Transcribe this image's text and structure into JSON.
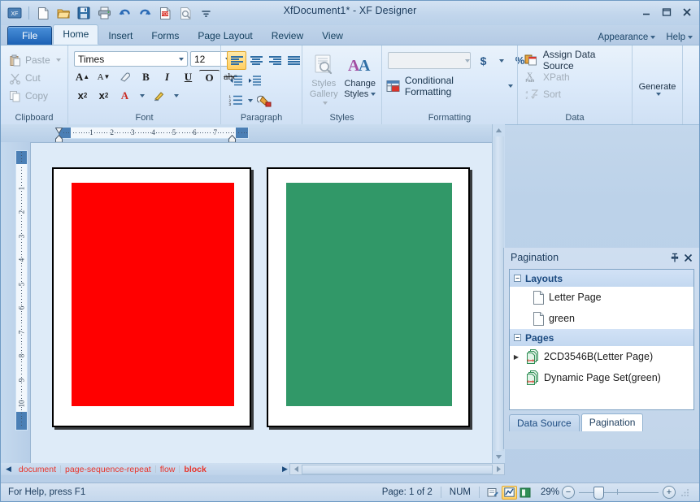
{
  "window": {
    "title": "XfDocument1* - XF Designer",
    "minimize": "minimize-button",
    "maximize": "maximize-button",
    "close": "close-button"
  },
  "quick_access": {
    "items": [
      {
        "name": "app-logo-icon",
        "label": "XF"
      },
      {
        "name": "new-document-icon",
        "label": "New"
      },
      {
        "name": "open-folder-icon",
        "label": "Open"
      },
      {
        "name": "save-icon",
        "label": "Save"
      },
      {
        "name": "print-icon",
        "label": "Print"
      },
      {
        "name": "undo-icon",
        "label": "Undo"
      },
      {
        "name": "redo-icon",
        "label": "Redo"
      },
      {
        "name": "pdf-export-icon",
        "label": "Export PDF"
      },
      {
        "name": "preview-icon",
        "label": "Print Preview"
      },
      {
        "name": "customize-qat-icon",
        "label": "Customize"
      }
    ]
  },
  "tabs": {
    "file": "File",
    "items": [
      {
        "label": "Home",
        "active": true
      },
      {
        "label": "Insert",
        "active": false
      },
      {
        "label": "Forms",
        "active": false
      },
      {
        "label": "Page Layout",
        "active": false
      },
      {
        "label": "Review",
        "active": false
      },
      {
        "label": "View",
        "active": false
      }
    ],
    "right": [
      {
        "label": "Appearance"
      },
      {
        "label": "Help"
      }
    ]
  },
  "ribbon": {
    "clipboard": {
      "label": "Clipboard",
      "paste": "Paste",
      "cut": "Cut",
      "copy": "Copy"
    },
    "font": {
      "label": "Font",
      "font_name": "Times",
      "font_size": "12",
      "buttons": [
        {
          "name": "grow-font",
          "glyph": "A"
        },
        {
          "name": "shrink-font",
          "glyph": "A"
        },
        {
          "name": "clear-formatting",
          "glyph": "eraser"
        },
        {
          "name": "bold",
          "glyph": "B"
        },
        {
          "name": "italic",
          "glyph": "I"
        },
        {
          "name": "underline",
          "glyph": "U"
        },
        {
          "name": "overline",
          "glyph": "O"
        },
        {
          "name": "strikethrough",
          "glyph": "abc"
        },
        {
          "name": "subscript",
          "glyph": "x2"
        },
        {
          "name": "superscript",
          "glyph": "x2"
        },
        {
          "name": "font-color",
          "glyph": "A"
        },
        {
          "name": "highlight-color",
          "glyph": "pen"
        }
      ]
    },
    "paragraph": {
      "label": "Paragraph",
      "align_left": "Align Left",
      "align_center": "Center",
      "align_right": "Align Right",
      "justify": "Justify",
      "decrease_indent": "Decrease Indent",
      "increase_indent": "Increase Indent",
      "numbering": "Numbering",
      "shading": "Shading"
    },
    "styles": {
      "label": "Styles",
      "styles_gallery": "Styles\nGallery",
      "styles_gallery_line1": "Styles",
      "styles_gallery_line2": "Gallery",
      "change_styles_line1": "Change",
      "change_styles_line2": "Styles"
    },
    "formatting": {
      "label": "Formatting",
      "number_format_value": "",
      "currency": "$",
      "percent": "%",
      "conditional_formatting": "Conditional Formatting"
    },
    "data": {
      "label": "Data",
      "assign_data_source": "Assign Data Source",
      "xpath": "XPath",
      "sort": "Sort",
      "generate": "Generate"
    }
  },
  "ruler": {
    "horizontal_numbers": [
      "1",
      "2",
      "3",
      "4",
      "5",
      "6",
      "7"
    ],
    "vertical_numbers": [
      "1",
      "2",
      "3",
      "4",
      "5",
      "6",
      "7",
      "8",
      "9",
      "10"
    ]
  },
  "canvas": {
    "pages": [
      {
        "name": "page-red",
        "color": "#FF0000"
      },
      {
        "name": "page-green",
        "color": "#319868"
      }
    ]
  },
  "breadcrumb": {
    "items": [
      {
        "label": "document",
        "current": false
      },
      {
        "label": "page-sequence-repeat",
        "current": false
      },
      {
        "label": "flow",
        "current": false
      },
      {
        "label": "block",
        "current": true
      }
    ]
  },
  "panel": {
    "title": "Pagination",
    "pin": "auto-hide-button",
    "close": "close-panel-button",
    "groups": [
      {
        "name": "Layouts",
        "nodes": [
          {
            "label": "Letter Page",
            "icon": "page-icon",
            "twisty": false
          },
          {
            "label": "green",
            "icon": "page-icon",
            "twisty": false
          }
        ]
      },
      {
        "name": "Pages",
        "nodes": [
          {
            "label": "2CD3546B(Letter Page)",
            "icon": "page-set-icon",
            "twisty": true
          },
          {
            "label": "Dynamic Page Set(green)",
            "icon": "page-set-icon",
            "twisty": false
          }
        ]
      }
    ],
    "tabs": [
      {
        "label": "Data Source",
        "active": false
      },
      {
        "label": "Pagination",
        "active": true
      }
    ]
  },
  "statusbar": {
    "help": "For Help, press F1",
    "page": "Page: 1 of 2",
    "num": "NUM",
    "view_buttons": [
      {
        "name": "design-view-icon",
        "active": false
      },
      {
        "name": "layout-view-icon",
        "active": true
      },
      {
        "name": "preview-view-icon",
        "active": false
      }
    ],
    "zoom": "29%",
    "zoom_out": "−",
    "zoom_in": "+"
  },
  "colors": {
    "accent": "#1c61b4",
    "breadcrumb_text": "#e8342a",
    "red_block": "#FF0000",
    "green_block": "#319868",
    "chrome": "#bcd2e9"
  }
}
